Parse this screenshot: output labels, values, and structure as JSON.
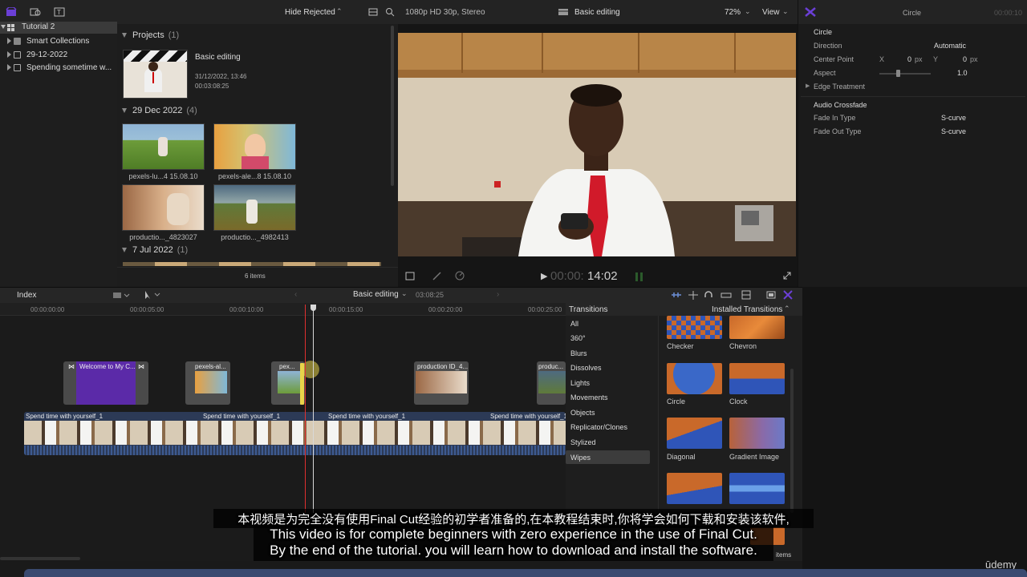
{
  "toolbar": {
    "hide_rejected": "Hide Rejected",
    "format": "1080p HD 30p, Stereo",
    "project_name": "Basic editing",
    "zoom": "72%",
    "view": "View",
    "inspector_title": "Circle",
    "timecode_dim": "00:00:10"
  },
  "library": {
    "items": [
      {
        "label": "Tutorial 2"
      },
      {
        "label": "Smart Collections"
      },
      {
        "label": "29-12-2022"
      },
      {
        "label": "Spending sometime w..."
      }
    ]
  },
  "browser": {
    "projects_header": "Projects",
    "projects_count": "(1)",
    "project": {
      "name": "Basic editing",
      "date": "31/12/2022, 13:46",
      "duration": "00:03:08:25"
    },
    "event1_header": "29 Dec 2022",
    "event1_count": "(4)",
    "clips": [
      {
        "label": "pexels-lu...4 15.08.10"
      },
      {
        "label": "pexels-ale...8 15.08.10"
      },
      {
        "label": "productio..._4823027"
      },
      {
        "label": "productio..._4982413"
      }
    ],
    "event2_header": "7 Jul 2022",
    "event2_count": "(1)",
    "items_count": "6 items"
  },
  "viewer": {
    "timecode_dim": "00:00:",
    "timecode": "14:02"
  },
  "inspector": {
    "section": "Circle",
    "direction_label": "Direction",
    "direction_value": "Automatic",
    "center_label": "Center Point",
    "x_label": "X",
    "x_value": "0",
    "x_unit": "px",
    "y_label": "Y",
    "y_value": "0",
    "y_unit": "px",
    "aspect_label": "Aspect",
    "aspect_value": "1.0",
    "edge_label": "Edge Treatment",
    "audio_section": "Audio Crossfade",
    "fade_in_label": "Fade In Type",
    "fade_in_value": "S-curve",
    "fade_out_label": "Fade Out Type",
    "fade_out_value": "S-curve"
  },
  "timeline": {
    "index": "Index",
    "project_name": "Basic editing",
    "duration": "03:08:25",
    "ruler": [
      "00:00:00:00",
      "00:00:05:00",
      "00:00:10:00",
      "00:00:15:00",
      "00:00:20:00",
      "00:00:25:00"
    ],
    "connected": [
      {
        "title": "Welcome to My C..."
      },
      {
        "title": "pexels-al..."
      },
      {
        "title": "pex..."
      },
      {
        "title": "production ID_4..."
      },
      {
        "title": "produc..."
      }
    ],
    "primary": [
      {
        "title": "Spend time with yourself_1"
      },
      {
        "title": "Spend time with yourself_1"
      },
      {
        "title": "Spend time with yourself_1"
      },
      {
        "title": "Spend time with yourself_1"
      }
    ]
  },
  "transitions": {
    "title": "Transitions",
    "installed": "Installed Transitions",
    "categories": [
      "All",
      "360°",
      "Blurs",
      "Dissolves",
      "Lights",
      "Movements",
      "Objects",
      "Replicator/Clones",
      "Stylized",
      "Wipes"
    ],
    "selected_category": "Wipes",
    "items": [
      "Checker",
      "Chevron",
      "Circle",
      "Clock",
      "Diagonal",
      "Gradient Image"
    ],
    "items_label": "items"
  },
  "subtitles": {
    "line_zh": "本视频是为完全没有使用Final Cut经验的初学者准备的,在本教程结束时,你将学会如何下载和安装该软件,",
    "line_en1": "This video is for complete beginners with zero experience in the use of Final Cut.",
    "line_en2": "By the end of the tutorial. you will learn how to download and install the software."
  },
  "watermark": "ūdemy",
  "colors": {
    "accent_purple": "#6b3fd6",
    "playhead": "#e03030",
    "selection_yellow": "#e8d44a",
    "connected_title_purple": "#5b2aa8"
  }
}
